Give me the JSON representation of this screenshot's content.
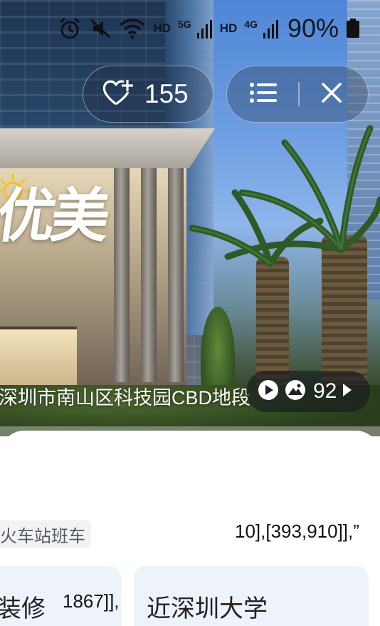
{
  "status_bar": {
    "signal_1_label": "HD",
    "network_1": "5G",
    "signal_2_label": "HD",
    "network_2": "4G",
    "battery_percent": "90%"
  },
  "favorite": {
    "count": "155",
    "icon": "heart-plus-icon"
  },
  "actions": {
    "menu_icon": "list-icon",
    "close_icon": "close-icon"
  },
  "hero": {
    "address": "深圳市南山区科技园CBD地段",
    "brush_text": "优美",
    "media_count": "92",
    "media_icons": [
      "play-circle-icon",
      "mountain-photo-icon",
      "arrow-right-icon"
    ]
  },
  "info": {
    "tag": "火车站班车",
    "stray_text_1": "10],[393,910]],”",
    "stray_text_2": "1867]],"
  },
  "cards": [
    {
      "label": "装修"
    },
    {
      "label": "近深圳大学"
    }
  ]
}
